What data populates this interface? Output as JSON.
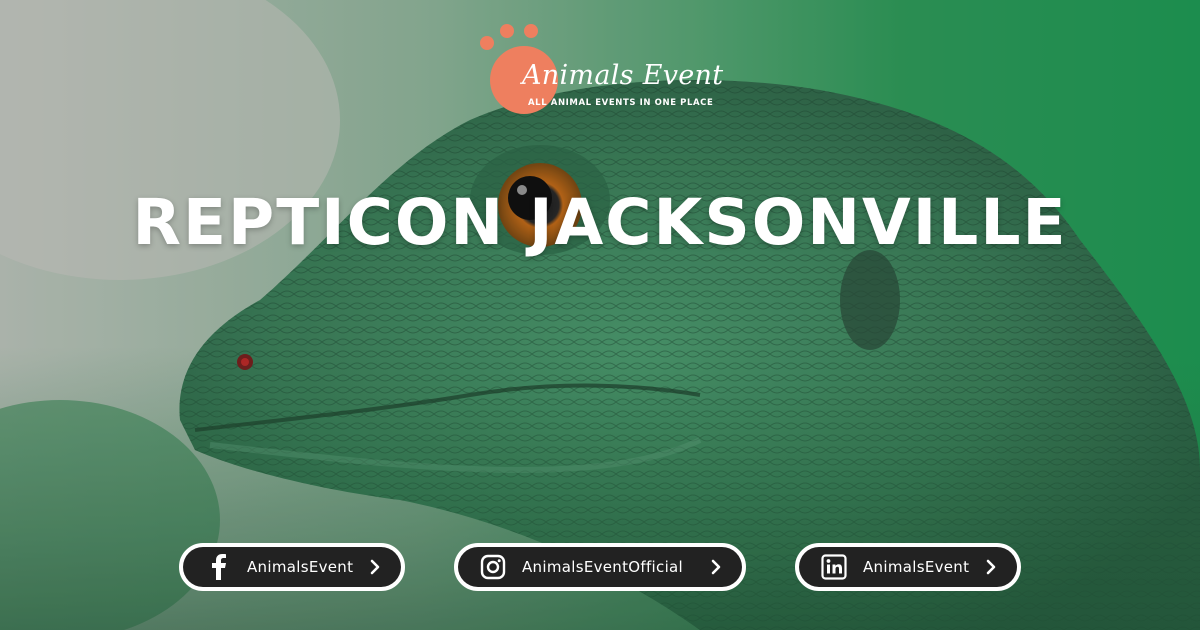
{
  "logo": {
    "name": "Animals Event",
    "tagline": "ALL ANIMAL EVENTS IN ONE PLACE"
  },
  "title": "REPTICON JACKSONVILLE",
  "social": [
    {
      "platform": "facebook",
      "icon": "facebook-icon",
      "handle": "AnimalsEvent"
    },
    {
      "platform": "instagram",
      "icon": "instagram-icon",
      "handle": "AnimalsEventOfficial"
    },
    {
      "platform": "linkedin",
      "icon": "linkedin-icon",
      "handle": "AnimalsEvent"
    }
  ],
  "colors": {
    "brand": "#ee7f5f",
    "pill_bg": "#222222",
    "pill_border": "#ffffff",
    "text": "#ffffff"
  }
}
